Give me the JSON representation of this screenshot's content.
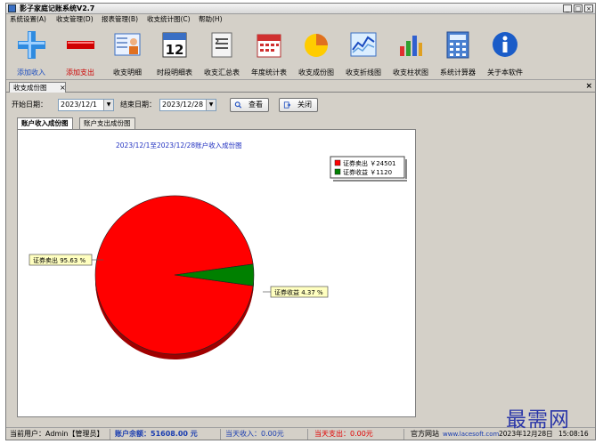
{
  "window": {
    "title": "影子家庭记账系统V2.7",
    "controls": [
      "_",
      "□",
      "×"
    ]
  },
  "menu": [
    "系统设置(A)",
    "收支管理(D)",
    "报表管理(B)",
    "收支统计图(C)",
    "帮助(H)"
  ],
  "toolbar": [
    {
      "label": "添加收入",
      "icon": "plus-icon"
    },
    {
      "label": "添加支出",
      "icon": "minus-icon"
    },
    {
      "label": "收支明细",
      "icon": "person-card-icon"
    },
    {
      "label": "时段明细表",
      "icon": "calendar-icon",
      "icon_text": "12"
    },
    {
      "label": "收支汇总表",
      "icon": "list-document-icon"
    },
    {
      "label": "年度统计表",
      "icon": "year-calendar-icon"
    },
    {
      "label": "收支成份图",
      "icon": "pie-chart-icon"
    },
    {
      "label": "收支折线图",
      "icon": "line-chart-icon"
    },
    {
      "label": "收支柱状图",
      "icon": "bar-chart-icon"
    },
    {
      "label": "系统计算器",
      "icon": "calculator-icon"
    },
    {
      "label": "关于本软件",
      "icon": "info-icon"
    }
  ],
  "doc_tab": {
    "label": "收支成份图",
    "close": "×"
  },
  "panel_close": "×",
  "filters": {
    "start_label": "开始日期：",
    "start_value": "2023/12/1",
    "end_label": "结束日期：",
    "end_value": "2023/12/28",
    "query_label": "查看",
    "close_label": "关闭"
  },
  "subtabs": [
    "账户收入成份图",
    "账户支出成份图"
  ],
  "chart_data": {
    "type": "pie",
    "title": "2023/12/1至2023/12/28账户收入成份图",
    "slices": [
      {
        "name": "证券卖出",
        "value": 24501,
        "percent": 95.63,
        "color": "#ff0000",
        "legend_text": "证券卖出 ￥24501",
        "label_text": "证券卖出 95.63 %"
      },
      {
        "name": "证券收益",
        "value": 1120,
        "percent": 4.37,
        "color": "#008000",
        "legend_text": "证券收益 ￥1120",
        "label_text": "证券收益 4.37 %"
      }
    ],
    "legend_placement": "top-right"
  },
  "status": {
    "user": "当前用户：Admin【管理员】",
    "balance": "账户余额：51608.00 元",
    "today_income": "当天收入：0.00元",
    "today_expense": "当天支出：0.00元",
    "site_label": "官方网站",
    "site_url": "www.lacesoft.com",
    "date": "2023年12月28日",
    "time": "15:08:16"
  },
  "watermark": "最需网",
  "colors": {
    "accent_blue": "#1a4cc0",
    "income_red": "#e00000",
    "toolbar_red_label": "#cc0000",
    "link_blue": "#1a3db0"
  }
}
